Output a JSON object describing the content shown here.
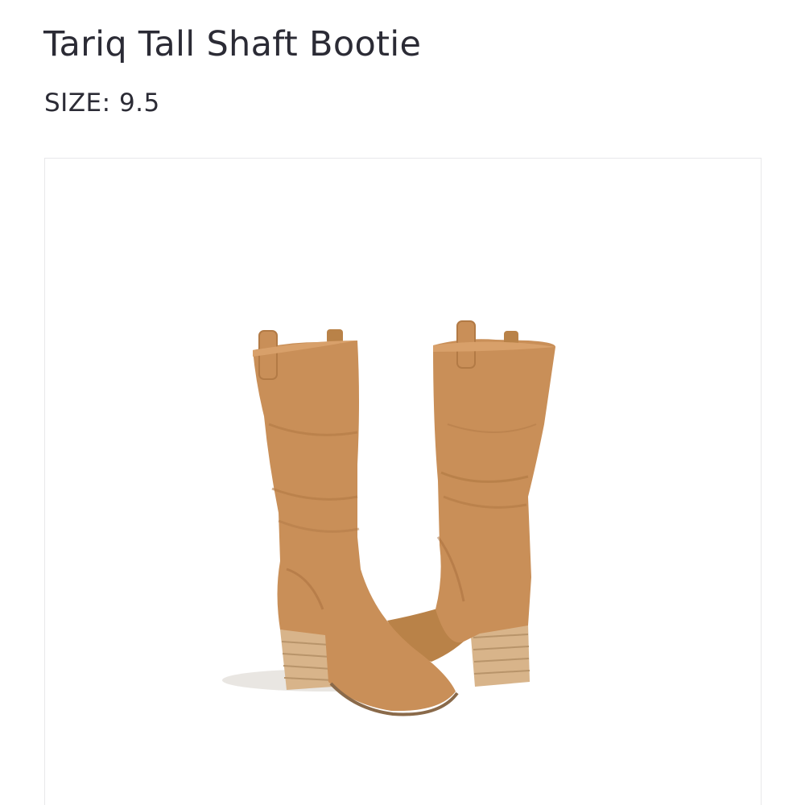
{
  "product": {
    "title": "Tariq Tall Shaft Bootie",
    "size_label": "SIZE:",
    "size_value": "9.5"
  },
  "colors": {
    "suede": "#c98f58",
    "suede_dark": "#b27a45",
    "suede_light": "#d8a06a",
    "heel_wood": "#d8b48a",
    "heel_stripe": "#b8946a",
    "sole": "#8a6a4a"
  },
  "icons": {
    "product_image": "tall-suede-boots-photo"
  }
}
